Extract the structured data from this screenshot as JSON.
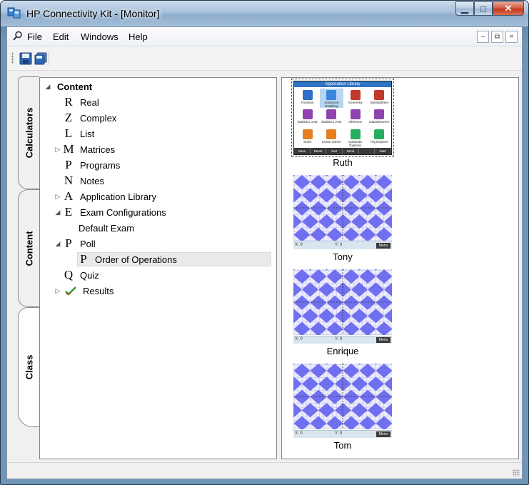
{
  "window": {
    "title": "HP Connectivity Kit - [Monitor]",
    "controls": {
      "minimize": "▁",
      "maximize": "□",
      "close": "✕"
    }
  },
  "menubar": {
    "items": [
      "File",
      "Edit",
      "Windows",
      "Help"
    ],
    "mdi": {
      "minimize": "–",
      "restore": "⧉",
      "close": "×"
    }
  },
  "toolbar": {
    "buttons": [
      "save-icon",
      "save-all-icon"
    ]
  },
  "side_tabs": [
    "Calculators",
    "Content",
    "Class"
  ],
  "active_tab": "Class",
  "tree": {
    "root": "Content",
    "items": [
      {
        "letter": "R",
        "label": "Real",
        "expander": ""
      },
      {
        "letter": "Z",
        "label": "Complex",
        "expander": ""
      },
      {
        "letter": "L",
        "label": "List",
        "expander": ""
      },
      {
        "letter": "M",
        "label": "Matrices",
        "expander": "▷"
      },
      {
        "letter": "P",
        "label": "Programs",
        "expander": ""
      },
      {
        "letter": "N",
        "label": "Notes",
        "expander": ""
      },
      {
        "letter": "A",
        "label": "Application Library",
        "expander": "▷"
      },
      {
        "letter": "E",
        "label": "Exam Configurations",
        "expander": "◢"
      },
      {
        "letter": "",
        "label": "Default Exam",
        "expander": ""
      },
      {
        "letter": "P",
        "label": "Poll",
        "expander": "◢"
      },
      {
        "letter": "P",
        "label": "Order of Operations",
        "expander": "",
        "selected": true
      },
      {
        "letter": "Q",
        "label": "Quiz",
        "expander": ""
      },
      {
        "letter": "",
        "label": "Results",
        "expander": "▷"
      }
    ],
    "root_expander": "◢"
  },
  "students": [
    {
      "name": "Ruth",
      "screen": "application-library"
    },
    {
      "name": "Tony",
      "screen": "graph"
    },
    {
      "name": "Enrique",
      "screen": "graph"
    },
    {
      "name": "Tom",
      "screen": "graph"
    }
  ],
  "app_library": {
    "title": "Application Library",
    "apps": [
      {
        "label": "Function",
        "color": "#2f6fc7"
      },
      {
        "label": "Advanced Graphing",
        "color": "#3a86d9",
        "selected": true
      },
      {
        "label": "Geometry",
        "color": "#c0392b"
      },
      {
        "label": "Spreadsheet",
        "color": "#c0392b"
      },
      {
        "label": "Statistics 1Var",
        "color": "#8e44ad"
      },
      {
        "label": "Statistics 2Var",
        "color": "#8e44ad"
      },
      {
        "label": "Inference",
        "color": "#8e44ad"
      },
      {
        "label": "DataStreamer",
        "color": "#8e44ad"
      },
      {
        "label": "Solve",
        "color": "#e67e22"
      },
      {
        "label": "Linear Solver",
        "color": "#e67e22"
      },
      {
        "label": "Quadratic Explorer",
        "color": "#27ae60"
      },
      {
        "label": "Trig Explorer",
        "color": "#27ae60"
      }
    ],
    "softkeys": [
      "Save",
      "Reset",
      "Sort",
      "Send",
      "",
      "Start"
    ]
  },
  "graph_footer": {
    "x": "X: 0",
    "y": "Y: 0",
    "menu": "Menu"
  },
  "colors": {
    "checker": "#6f6fef",
    "selection": "#eaeaea"
  }
}
